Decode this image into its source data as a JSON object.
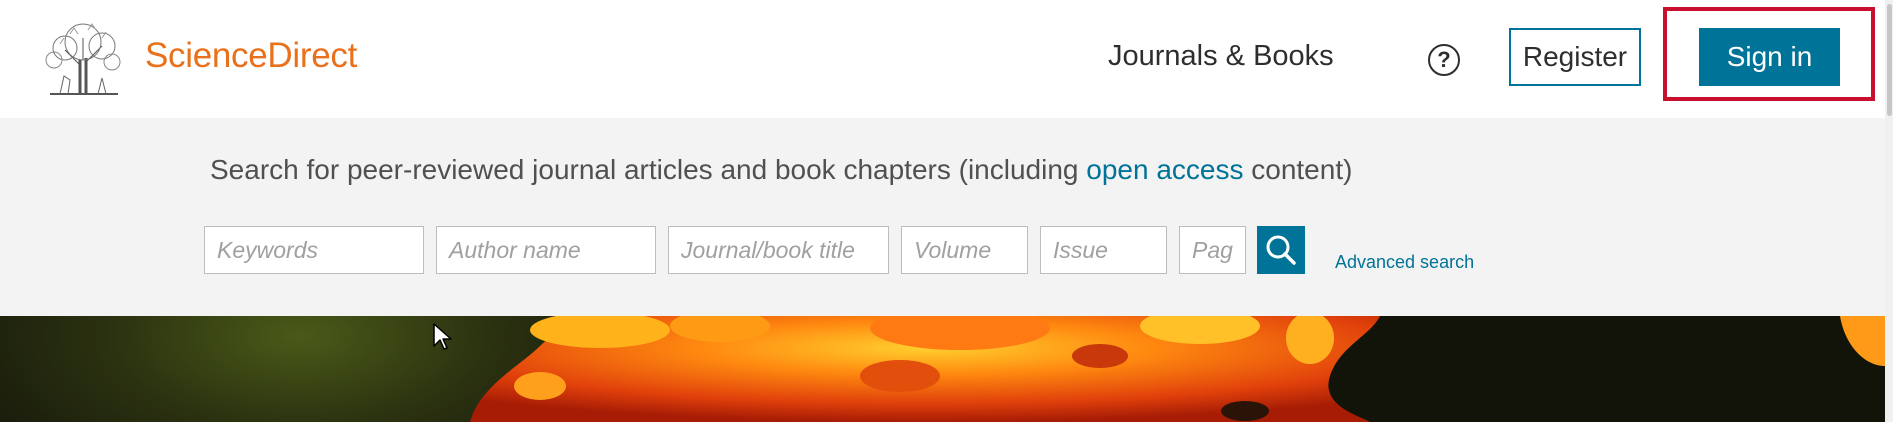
{
  "header": {
    "brand": "ScienceDirect",
    "nav_journals": "Journals & Books",
    "help_icon_label": "?",
    "register_label": "Register",
    "signin_label": "Sign in"
  },
  "search": {
    "tagline_prefix": "Search for peer-reviewed journal articles and book chapters (including ",
    "tagline_link": "open access",
    "tagline_suffix": " content)",
    "fields": {
      "keywords": "Keywords",
      "author": "Author name",
      "journal": "Journal/book title",
      "volume": "Volume",
      "issue": "Issue",
      "pages": "Pag"
    },
    "advanced_label": "Advanced search"
  },
  "colors": {
    "brand_orange": "#e9711c",
    "accent_blue": "#007398",
    "highlight_red": "#c8102e"
  },
  "icons": [
    "elsevier-tree-logo",
    "help-icon",
    "search-icon",
    "mouse-cursor-icon"
  ]
}
